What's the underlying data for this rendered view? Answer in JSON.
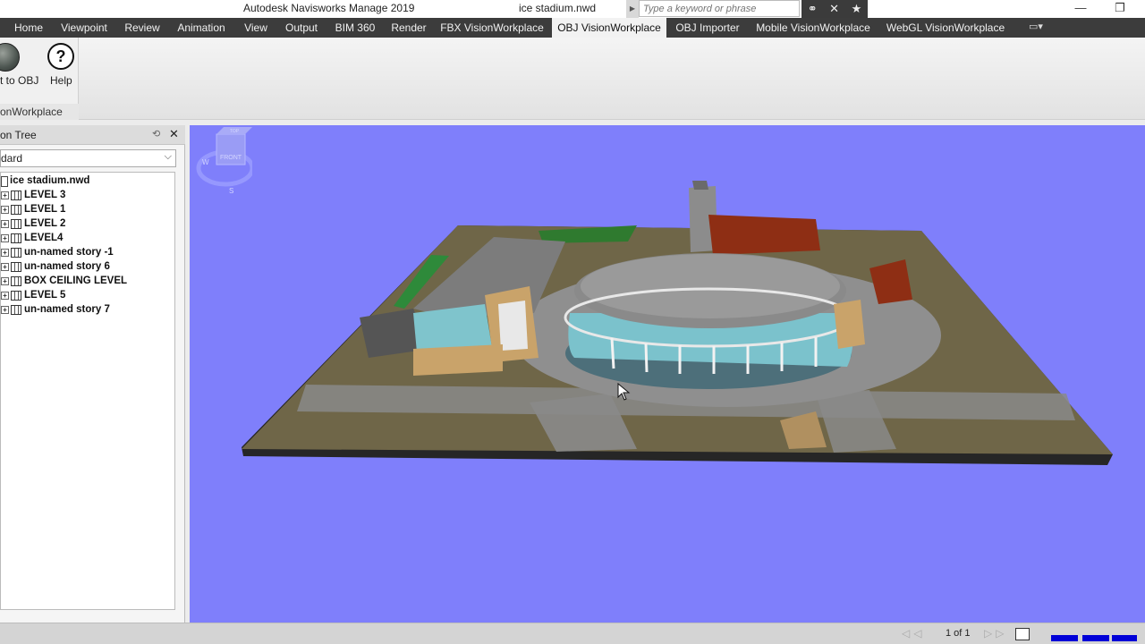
{
  "window": {
    "app_title": "Autodesk Navisworks Manage 2019",
    "doc_title": "ice stadium.nwd",
    "search_placeholder": "Type a keyword or phrase",
    "minimize": "—",
    "restore": "❐"
  },
  "tabs": [
    "Home",
    "Viewpoint",
    "Review",
    "Animation",
    "View",
    "Output",
    "BIM 360",
    "Render",
    "FBX VisionWorkplace",
    "OBJ VisionWorkplace",
    "OBJ Importer",
    "Mobile VisionWorkplace",
    "WebGL VisionWorkplace"
  ],
  "active_tab": "OBJ VisionWorkplace",
  "ribbon": {
    "convert_label": "rt to OBJ",
    "help_label": "Help",
    "group_title": "onWorkplace"
  },
  "selection_tree": {
    "title": "on Tree",
    "dropdown_value": "dard",
    "root": "ice stadium.nwd",
    "items": [
      "LEVEL 3",
      "LEVEL 1",
      "LEVEL 2",
      "LEVEL4",
      "un-named story -1",
      "un-named story 6",
      "BOX CEILING LEVEL",
      "LEVEL 5",
      "un-named story 7"
    ]
  },
  "viewcube": {
    "face": "FRONT",
    "top": "TOP",
    "west": "W",
    "south": "S"
  },
  "status": {
    "page_count": "1 of 1"
  },
  "colors": {
    "viewport_bg": "#7f7ffb",
    "tabbar_bg": "#3c3c3c",
    "perf_bar": "#0000d8"
  }
}
